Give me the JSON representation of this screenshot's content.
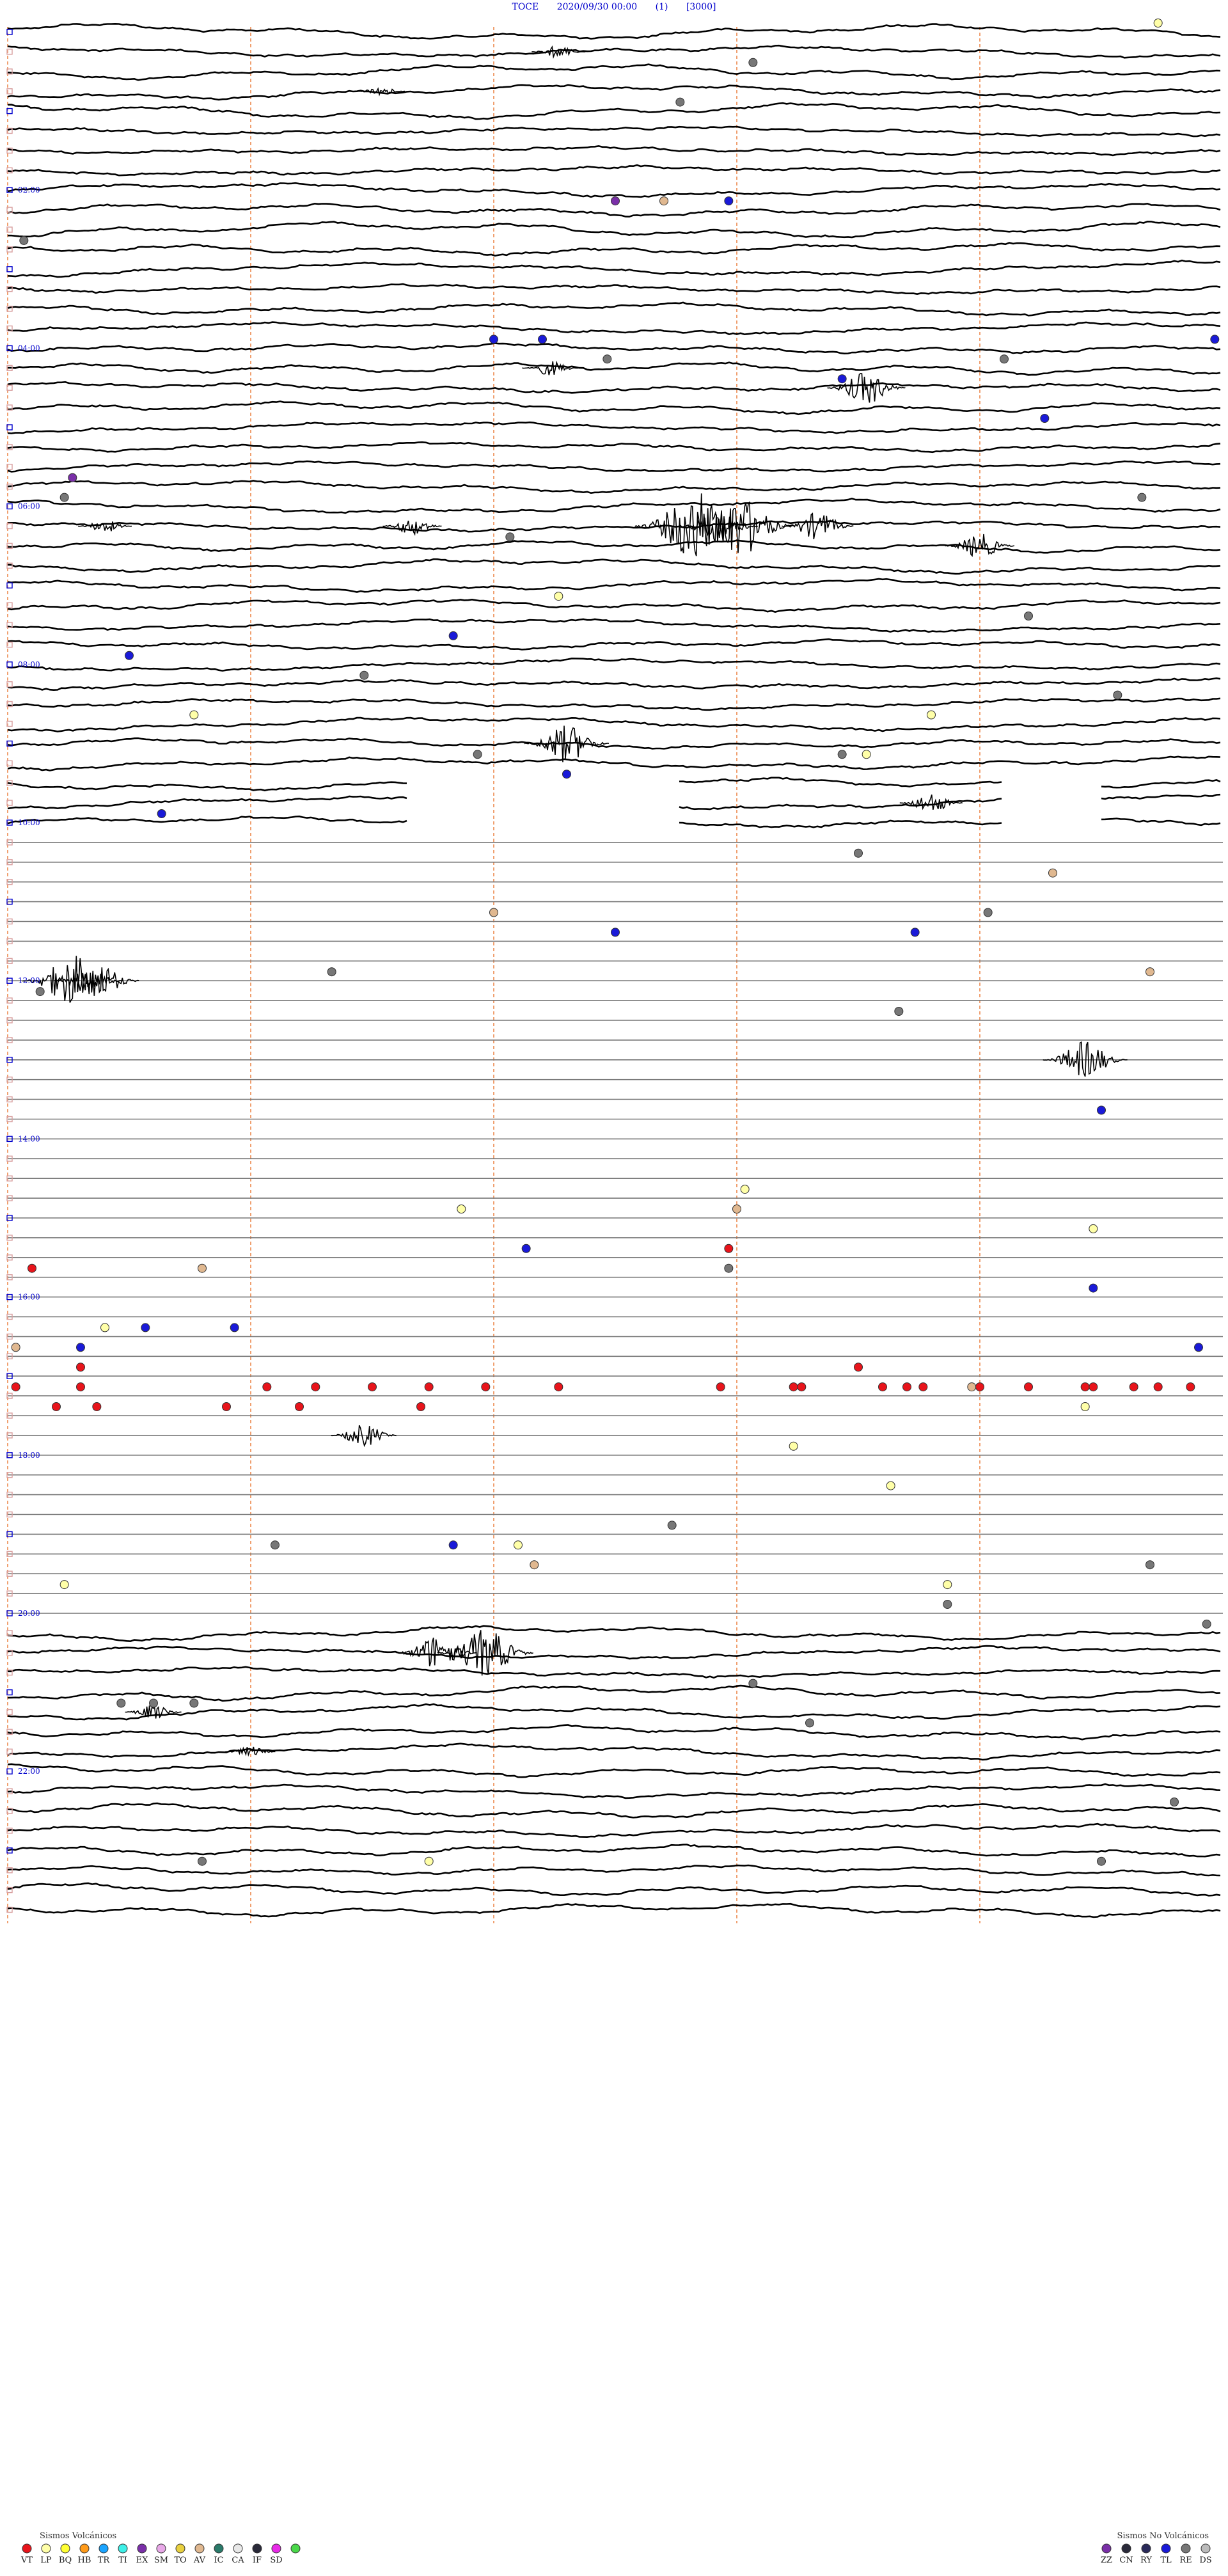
{
  "header": {
    "station": "TOCE",
    "datetime": "2020/09/30 00:00",
    "channel": "(1)",
    "scale": "[3000]"
  },
  "chart_data": {
    "type": "helicorder",
    "rows_total": 96,
    "minutes_per_row": 15,
    "hour_labels": [
      {
        "row": 8,
        "text": "02:00"
      },
      {
        "row": 16,
        "text": "04:00"
      },
      {
        "row": 24,
        "text": "06:00"
      },
      {
        "row": 32,
        "text": "08:00"
      },
      {
        "row": 40,
        "text": "10:00"
      },
      {
        "row": 48,
        "text": "12:00"
      },
      {
        "row": 56,
        "text": "14:00"
      },
      {
        "row": 64,
        "text": "16:00"
      },
      {
        "row": 72,
        "text": "18:00"
      },
      {
        "row": 80,
        "text": "20:00"
      },
      {
        "row": 88,
        "text": "22:00"
      }
    ],
    "minute_markers": [
      3,
      6,
      9,
      12
    ],
    "segments": [
      {
        "rows": [
          0,
          37
        ],
        "style": "noisy"
      },
      {
        "rows": [
          38,
          40
        ],
        "style": "gappy"
      },
      {
        "rows": [
          41,
          80
        ],
        "style": "flat"
      },
      {
        "rows": [
          81,
          96
        ],
        "style": "noisy"
      }
    ],
    "bursts": [
      {
        "row": 1,
        "minute": 6.8,
        "amplitude": 10
      },
      {
        "row": 3,
        "minute": 4.6,
        "amplitude": 8
      },
      {
        "row": 17,
        "minute": 6.7,
        "amplitude": 12
      },
      {
        "row": 18,
        "minute": 10.6,
        "amplitude": 26
      },
      {
        "row": 25,
        "minute": 1.2,
        "amplitude": 10
      },
      {
        "row": 25,
        "minute": 5.0,
        "amplitude": 14
      },
      {
        "row": 25,
        "minute": 8.5,
        "amplitude": 55
      },
      {
        "row": 25,
        "minute": 9.0,
        "amplitude": 50
      },
      {
        "row": 25,
        "minute": 10.0,
        "amplitude": 22
      },
      {
        "row": 26,
        "minute": 12.0,
        "amplitude": 20
      },
      {
        "row": 36,
        "minute": 6.9,
        "amplitude": 30
      },
      {
        "row": 39,
        "minute": 11.4,
        "amplitude": 16
      },
      {
        "row": 48,
        "minute": 0.8,
        "amplitude": 40
      },
      {
        "row": 48,
        "minute": 1.1,
        "amplitude": 30
      },
      {
        "row": 52,
        "minute": 13.3,
        "amplitude": 30
      },
      {
        "row": 71,
        "minute": 4.4,
        "amplitude": 18
      },
      {
        "row": 82,
        "minute": 5.3,
        "amplitude": 28
      },
      {
        "row": 82,
        "minute": 5.9,
        "amplitude": 38
      },
      {
        "row": 85,
        "minute": 1.8,
        "amplitude": 12
      },
      {
        "row": 87,
        "minute": 3.0,
        "amplitude": 8
      }
    ],
    "events": [
      {
        "row": 0,
        "minute": 14.2,
        "type": "LP"
      },
      {
        "row": 2,
        "minute": 9.2,
        "type": "RE"
      },
      {
        "row": 4,
        "minute": 8.3,
        "type": "RE"
      },
      {
        "row": 9,
        "minute": 7.5,
        "type": "EX"
      },
      {
        "row": 9,
        "minute": 8.1,
        "type": "AV"
      },
      {
        "row": 9,
        "minute": 8.9,
        "type": "TL"
      },
      {
        "row": 11,
        "minute": 0.2,
        "type": "RE"
      },
      {
        "row": 16,
        "minute": 6.0,
        "type": "TL"
      },
      {
        "row": 16,
        "minute": 6.6,
        "type": "TL"
      },
      {
        "row": 16,
        "minute": 14.9,
        "type": "TL"
      },
      {
        "row": 17,
        "minute": 7.4,
        "type": "RE"
      },
      {
        "row": 17,
        "minute": 12.3,
        "type": "RE"
      },
      {
        "row": 18,
        "minute": 10.3,
        "type": "TL"
      },
      {
        "row": 20,
        "minute": 12.8,
        "type": "TL"
      },
      {
        "row": 23,
        "minute": 0.8,
        "type": "EX"
      },
      {
        "row": 24,
        "minute": 0.7,
        "type": "RE"
      },
      {
        "row": 24,
        "minute": 14.0,
        "type": "RE"
      },
      {
        "row": 26,
        "minute": 6.2,
        "type": "RE"
      },
      {
        "row": 29,
        "minute": 6.8,
        "type": "LP"
      },
      {
        "row": 30,
        "minute": 12.6,
        "type": "RE"
      },
      {
        "row": 31,
        "minute": 5.5,
        "type": "TL"
      },
      {
        "row": 32,
        "minute": 1.5,
        "type": "TL"
      },
      {
        "row": 33,
        "minute": 4.4,
        "type": "RE"
      },
      {
        "row": 34,
        "minute": 13.7,
        "type": "RE"
      },
      {
        "row": 35,
        "minute": 2.3,
        "type": "LP"
      },
      {
        "row": 35,
        "minute": 11.4,
        "type": "LP"
      },
      {
        "row": 37,
        "minute": 5.8,
        "type": "RE"
      },
      {
        "row": 37,
        "minute": 10.3,
        "type": "RE"
      },
      {
        "row": 37,
        "minute": 10.6,
        "type": "LP"
      },
      {
        "row": 38,
        "minute": 6.9,
        "type": "TL"
      },
      {
        "row": 40,
        "minute": 1.9,
        "type": "TL"
      },
      {
        "row": 42,
        "minute": 10.5,
        "type": "RE"
      },
      {
        "row": 43,
        "minute": 12.9,
        "type": "AV"
      },
      {
        "row": 45,
        "minute": 6.0,
        "type": "AV"
      },
      {
        "row": 45,
        "minute": 12.1,
        "type": "RE"
      },
      {
        "row": 46,
        "minute": 7.5,
        "type": "TL"
      },
      {
        "row": 46,
        "minute": 11.2,
        "type": "TL"
      },
      {
        "row": 48,
        "minute": 4.0,
        "type": "RE"
      },
      {
        "row": 48,
        "minute": 14.1,
        "type": "AV"
      },
      {
        "row": 49,
        "minute": 0.4,
        "type": "RE"
      },
      {
        "row": 50,
        "minute": 11.0,
        "type": "RE"
      },
      {
        "row": 55,
        "minute": 13.5,
        "type": "TL"
      },
      {
        "row": 59,
        "minute": 9.1,
        "type": "LP"
      },
      {
        "row": 60,
        "minute": 9.0,
        "type": "AV"
      },
      {
        "row": 60,
        "minute": 5.6,
        "type": "LP"
      },
      {
        "row": 61,
        "minute": 13.4,
        "type": "LP"
      },
      {
        "row": 62,
        "minute": 6.4,
        "type": "TL"
      },
      {
        "row": 62,
        "minute": 8.9,
        "type": "VT"
      },
      {
        "row": 63,
        "minute": 2.4,
        "type": "AV"
      },
      {
        "row": 63,
        "minute": 8.9,
        "type": "RE"
      },
      {
        "row": 63,
        "minute": 0.3,
        "type": "VT"
      },
      {
        "row": 64,
        "minute": 13.4,
        "type": "TL"
      },
      {
        "row": 66,
        "minute": 1.2,
        "type": "LP"
      },
      {
        "row": 66,
        "minute": 1.7,
        "type": "TL"
      },
      {
        "row": 66,
        "minute": 2.8,
        "type": "TL"
      },
      {
        "row": 67,
        "minute": 0.9,
        "type": "TL"
      },
      {
        "row": 67,
        "minute": 0.1,
        "type": "AV"
      },
      {
        "row": 67,
        "minute": 14.7,
        "type": "TL"
      },
      {
        "row": 68,
        "minute": 0.9,
        "type": "VT"
      },
      {
        "row": 68,
        "minute": 10.5,
        "type": "VT"
      },
      {
        "row": 69,
        "minute": 0.1,
        "type": "VT"
      },
      {
        "row": 69,
        "minute": 0.9,
        "type": "VT"
      },
      {
        "row": 69,
        "minute": 3.2,
        "type": "VT"
      },
      {
        "row": 69,
        "minute": 3.8,
        "type": "VT"
      },
      {
        "row": 69,
        "minute": 4.5,
        "type": "VT"
      },
      {
        "row": 69,
        "minute": 5.2,
        "type": "VT"
      },
      {
        "row": 69,
        "minute": 5.9,
        "type": "VT"
      },
      {
        "row": 69,
        "minute": 6.8,
        "type": "VT"
      },
      {
        "row": 69,
        "minute": 8.8,
        "type": "VT"
      },
      {
        "row": 69,
        "minute": 9.7,
        "type": "VT"
      },
      {
        "row": 69,
        "minute": 11.3,
        "type": "VT"
      },
      {
        "row": 69,
        "minute": 13.3,
        "type": "VT"
      },
      {
        "row": 69,
        "minute": 13.9,
        "type": "VT"
      },
      {
        "row": 69,
        "minute": 9.8,
        "type": "VT"
      },
      {
        "row": 69,
        "minute": 10.8,
        "type": "VT"
      },
      {
        "row": 69,
        "minute": 11.1,
        "type": "VT"
      },
      {
        "row": 69,
        "minute": 11.9,
        "type": "AV"
      },
      {
        "row": 69,
        "minute": 12.0,
        "type": "VT"
      },
      {
        "row": 69,
        "minute": 12.6,
        "type": "VT"
      },
      {
        "row": 69,
        "minute": 13.4,
        "type": "VT"
      },
      {
        "row": 69,
        "minute": 14.2,
        "type": "VT"
      },
      {
        "row": 69,
        "minute": 14.6,
        "type": "VT"
      },
      {
        "row": 70,
        "minute": 0.6,
        "type": "VT"
      },
      {
        "row": 70,
        "minute": 1.1,
        "type": "VT"
      },
      {
        "row": 70,
        "minute": 2.7,
        "type": "VT"
      },
      {
        "row": 70,
        "minute": 3.6,
        "type": "VT"
      },
      {
        "row": 70,
        "minute": 5.1,
        "type": "VT"
      },
      {
        "row": 70,
        "minute": 13.3,
        "type": "LP"
      },
      {
        "row": 72,
        "minute": 9.7,
        "type": "LP"
      },
      {
        "row": 74,
        "minute": 10.9,
        "type": "LP"
      },
      {
        "row": 76,
        "minute": 8.2,
        "type": "RE"
      },
      {
        "row": 77,
        "minute": 5.5,
        "type": "TL"
      },
      {
        "row": 77,
        "minute": 6.3,
        "type": "LP"
      },
      {
        "row": 77,
        "minute": 3.3,
        "type": "RE"
      },
      {
        "row": 78,
        "minute": 6.5,
        "type": "AV"
      },
      {
        "row": 78,
        "minute": 14.1,
        "type": "RE"
      },
      {
        "row": 79,
        "minute": 0.7,
        "type": "LP"
      },
      {
        "row": 79,
        "minute": 11.6,
        "type": "LP"
      },
      {
        "row": 80,
        "minute": 11.6,
        "type": "RE"
      },
      {
        "row": 81,
        "minute": 14.8,
        "type": "RE"
      },
      {
        "row": 84,
        "minute": 9.2,
        "type": "RE"
      },
      {
        "row": 85,
        "minute": 1.4,
        "type": "RE"
      },
      {
        "row": 85,
        "minute": 1.8,
        "type": "RE"
      },
      {
        "row": 85,
        "minute": 2.3,
        "type": "RE"
      },
      {
        "row": 86,
        "minute": 9.9,
        "type": "RE"
      },
      {
        "row": 90,
        "minute": 14.4,
        "type": "RE"
      },
      {
        "row": 93,
        "minute": 2.4,
        "type": "RE"
      },
      {
        "row": 93,
        "minute": 5.2,
        "type": "LP"
      },
      {
        "row": 93,
        "minute": 13.5,
        "type": "RE"
      }
    ]
  },
  "legend": {
    "volcanic_title": "Sismos Volcánicos",
    "volcanic": [
      {
        "code": "VT",
        "color": "#e8141b"
      },
      {
        "code": "LP",
        "color": "#ffffa8"
      },
      {
        "code": "BQ",
        "color": "#ffff33"
      },
      {
        "code": "HB",
        "color": "#ff9b1a"
      },
      {
        "code": "TR",
        "color": "#1aa4ff"
      },
      {
        "code": "TI",
        "color": "#3ef0e8"
      },
      {
        "code": "EX",
        "color": "#7a2fa8"
      },
      {
        "code": "SM",
        "color": "#e8a8e8"
      },
      {
        "code": "TO",
        "color": "#e8d040"
      },
      {
        "code": "AV",
        "color": "#e0b890"
      },
      {
        "code": "IC",
        "color": "#2a7a6a"
      },
      {
        "code": "CA",
        "color": "#e8e8e8"
      },
      {
        "code": "IF",
        "color": "#2a2a3a"
      },
      {
        "code": "SD",
        "color": "#e82ae8"
      },
      {
        "code": "",
        "color": "#4ad84a"
      }
    ],
    "nonvolcanic_title": "Sismos No Volcánicos",
    "nonvolcanic": [
      {
        "code": "ZZ",
        "color": "#7a2fa8"
      },
      {
        "code": "CN",
        "color": "#2a2a3a"
      },
      {
        "code": "RY",
        "color": "#2a2a5a"
      },
      {
        "code": "TL",
        "color": "#1a1ad8"
      },
      {
        "code": "RE",
        "color": "#777777"
      },
      {
        "code": "DS",
        "color": "#bbbbbb"
      }
    ]
  },
  "colors": {
    "trace": "#000000",
    "flat_trace": "#777777",
    "hour_label": "#0000cc",
    "minute_marker": "#f0a070"
  }
}
